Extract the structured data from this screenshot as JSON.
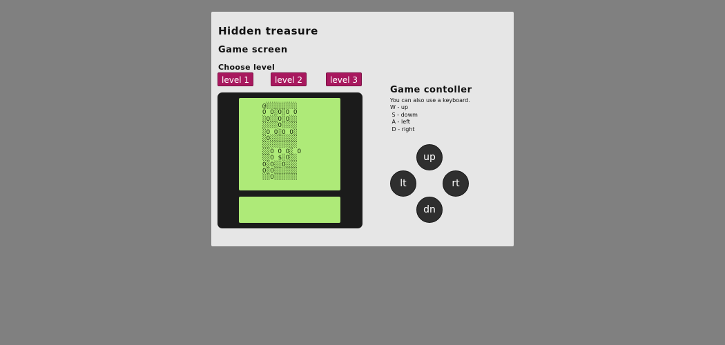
{
  "header": {
    "title": "Hidden treasure",
    "subtitle": "Game screen"
  },
  "levels": {
    "label": "Choose level",
    "buttons": [
      "level 1",
      "level 2",
      "level 3"
    ]
  },
  "game": {
    "grid_rows": [
      "@░░░░░░░░",
      "O O░O░O O",
      "░O░░O░O░░",
      "░░░░O░░░░",
      "░O O░O O░",
      "░O░░░░░░░",
      "░░░░░░░░░",
      "░░O O O░ O",
      "░░O $░O░░",
      "O░O░░O░░░",
      "O░O░░░░░░",
      "░░O░░░░░░"
    ],
    "message": "",
    "colors": {
      "screen": "#aeea78",
      "device": "#1b1b1b",
      "level_button": "#a8185e"
    }
  },
  "controller": {
    "title": "Game contoller",
    "hint_lines": [
      "You can also use a keyboard.",
      "W - up",
      " S - dowm",
      " A - left",
      " D - right"
    ],
    "buttons": {
      "up": "up",
      "left": "lt",
      "right": "rt",
      "down": "dn"
    }
  }
}
